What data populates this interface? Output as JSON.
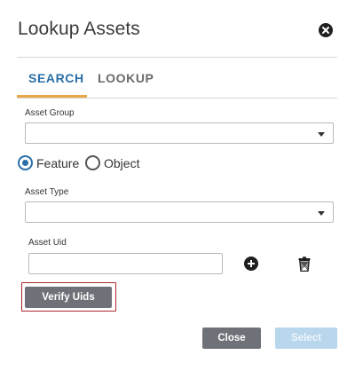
{
  "dialog": {
    "title": "Lookup Assets",
    "close_icon": "close-circle-icon"
  },
  "tabs": [
    {
      "label": "SEARCH",
      "active": true
    },
    {
      "label": "LOOKUP",
      "active": false
    }
  ],
  "form": {
    "asset_group": {
      "label": "Asset Group",
      "value": ""
    },
    "mode": {
      "options": [
        {
          "label": "Feature",
          "selected": true
        },
        {
          "label": "Object",
          "selected": false
        }
      ]
    },
    "asset_type": {
      "label": "Asset Type",
      "value": ""
    },
    "asset_uid": {
      "label": "Asset Uid",
      "value": "",
      "placeholder": ""
    },
    "add_icon": "plus-circle-icon",
    "delete_icon": "trash-icon",
    "verify_label": "Verify Uids"
  },
  "footer": {
    "close_label": "Close",
    "select_label": "Select",
    "select_enabled": false
  },
  "colors": {
    "accent_blue": "#2a6fa8",
    "tab_underline": "#e9a646",
    "button_gray": "#6e7177",
    "disabled_blue": "#b8d6ec",
    "highlight_red": "#b0262a"
  }
}
